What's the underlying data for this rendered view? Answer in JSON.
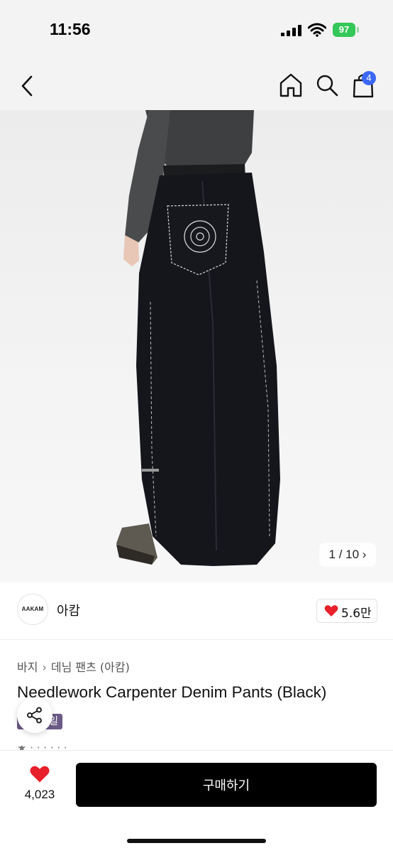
{
  "status_bar": {
    "time": "11:56",
    "battery": "97"
  },
  "header": {
    "icons": [
      "back-chevron-icon",
      "home-icon",
      "search-icon",
      "shopping-bag-icon"
    ],
    "cart_count": "4"
  },
  "gallery": {
    "counter": "1 / 10",
    "counter_icon": "chevron-right-icon"
  },
  "brand": {
    "logo_text": "AAKAM",
    "name": "아캄",
    "likes": "5.6만"
  },
  "product": {
    "breadcrumb": [
      "바지",
      "데님 팬츠 (아캄)"
    ],
    "title": "Needlework Carpenter Denim Pants (Black)",
    "sale_tag": "...한세일"
  },
  "bottom_bar": {
    "wish_count": "4,023",
    "buy_label": "구매하기"
  },
  "colors": {
    "accent_blue": "#3b67f5",
    "heart_red": "#e8202a",
    "battery_green": "#34c759",
    "sale_tag": "#6b5a86",
    "button_black": "#000000"
  }
}
